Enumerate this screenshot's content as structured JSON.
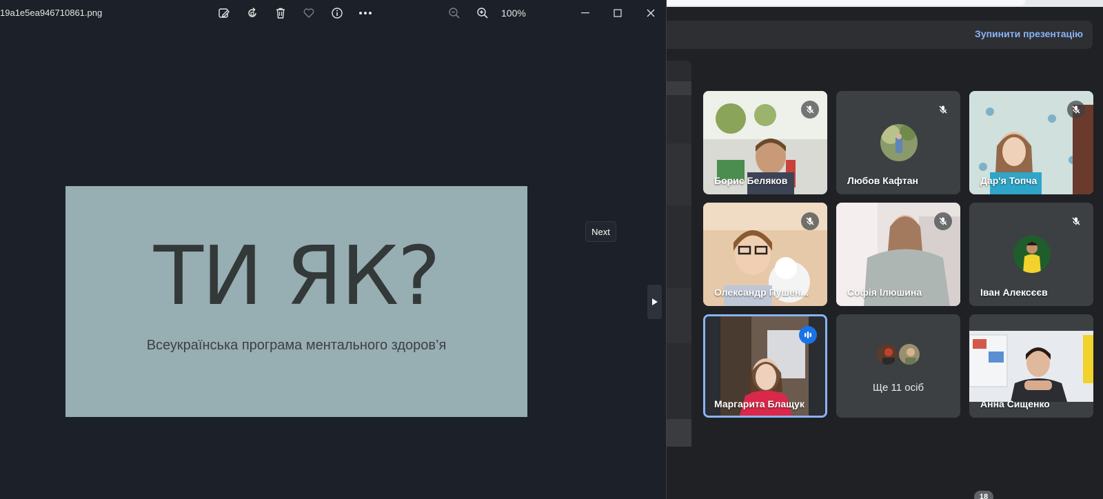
{
  "viewer": {
    "file_name": "19a1e5ea946710861.png",
    "zoom": "100%",
    "toolbar_icons": [
      "edit-image-icon",
      "rotate-icon",
      "delete-icon",
      "favorite-icon",
      "info-icon",
      "more-icon",
      "zoom-out-icon",
      "zoom-in-icon"
    ],
    "window_controls": [
      "minimize-icon",
      "maximize-icon",
      "close-icon"
    ],
    "next_tooltip": "Next"
  },
  "slide": {
    "title": "ТИ ЯК?",
    "subtitle": "Всеукраїнська програма ментального здоров’я",
    "background": "#97aeb3"
  },
  "meet": {
    "stop_presenting": "Зупинити презентацію",
    "participants": [
      {
        "name": "Борис Беляков",
        "muted": true
      },
      {
        "name": "Любов Кафтан",
        "muted": true
      },
      {
        "name": "Дар'я Топча",
        "muted": true
      },
      {
        "name": "Олександр Пушен...",
        "muted": true
      },
      {
        "name": "Софія Ілюшина",
        "muted": true
      },
      {
        "name": "Іван Алексєєв",
        "muted": true
      },
      {
        "name": "Маргарита Блащук",
        "speaking": true
      },
      {
        "name": "Анна Сищенко"
      }
    ],
    "more_people": "Ще 11 осіб",
    "participant_count": "18",
    "accent": "#8ab4f8"
  }
}
